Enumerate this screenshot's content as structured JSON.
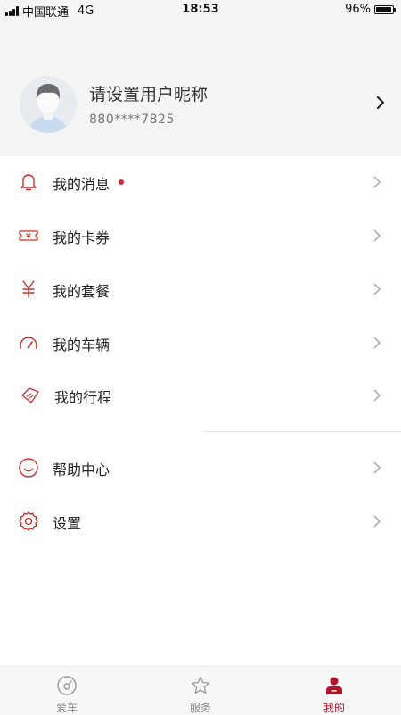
{
  "status_bar": {
    "carrier": "中国联通",
    "network": "4G",
    "time": "18:53",
    "battery": "96%",
    "battery_level": 0.96
  },
  "profile": {
    "nickname": "请设置用户昵称",
    "phone": "880****7825"
  },
  "menu": {
    "items": [
      {
        "label": "我的消息",
        "icon": "bell-icon",
        "has_dot": true
      },
      {
        "label": "我的卡券",
        "icon": "ticket-icon"
      },
      {
        "label": "我的套餐",
        "icon": "yen-icon"
      },
      {
        "label": "我的车辆",
        "icon": "speedometer-icon"
      },
      {
        "label": "我的行程",
        "icon": "route-tag-icon"
      },
      {
        "label": "帮助中心",
        "icon": "smile-icon"
      },
      {
        "label": "设置",
        "icon": "settings-gear-icon"
      }
    ]
  },
  "tabbar": {
    "tabs": [
      {
        "label": "爱车",
        "icon": "car-dial-icon"
      },
      {
        "label": "服务",
        "icon": "star-icon"
      },
      {
        "label": "我的",
        "icon": "person-icon",
        "active": true
      }
    ]
  },
  "colors": {
    "accent": "#b3162b",
    "icon_red": "#c8322e",
    "notification_dot": "#d12a2a",
    "header_bg": "#f5f5f5"
  }
}
